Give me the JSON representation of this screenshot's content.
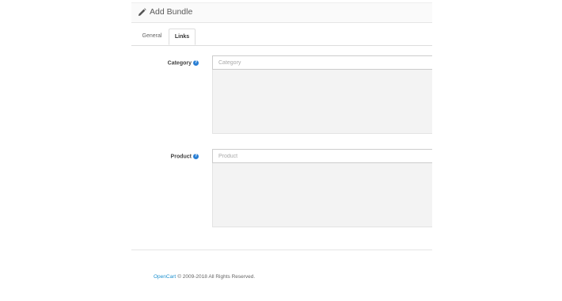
{
  "header": {
    "title": "Add Bundle",
    "icon": "pencil-icon"
  },
  "tabs": [
    {
      "label": "General",
      "active": false
    },
    {
      "label": "Links",
      "active": true
    }
  ],
  "form": {
    "category": {
      "label": "Category",
      "placeholder": "Category",
      "help_icon": "question-circle-icon"
    },
    "product": {
      "label": "Product",
      "placeholder": "Product",
      "help_icon": "question-circle-icon"
    }
  },
  "footer": {
    "link_text": "OpenCart",
    "copyright": "© 2009-2018 All Rights Reserved."
  },
  "colors": {
    "link": "#1e91cf",
    "help_icon": "#2a7fd4",
    "well_background": "#f3f3f3"
  }
}
